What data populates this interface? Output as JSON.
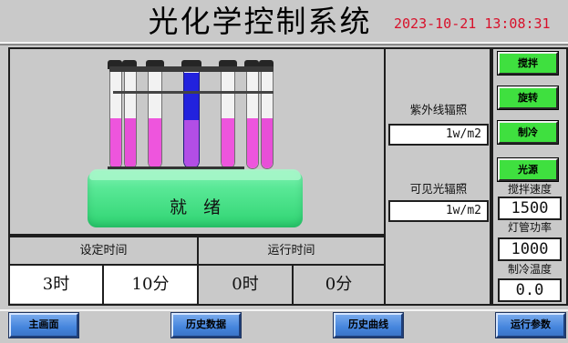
{
  "header": {
    "title": "光化学控制系统",
    "datetime": "2023-10-21  13:08:31"
  },
  "reactor": {
    "status": "就绪"
  },
  "time": {
    "set_label": "设定时间",
    "run_label": "运行时间",
    "set_hours": "3时",
    "set_minutes": "10分",
    "run_hours": "0时",
    "run_minutes": "0分"
  },
  "radiation": {
    "uv_label": "紫外线辐照",
    "uv_value": "1w/m2",
    "visible_label": "可见光辐照",
    "visible_value": "1w/m2"
  },
  "controls": {
    "stir_label": "搅拌",
    "rotate_label": "旋转",
    "cool_label": "制冷",
    "light_label": "光源"
  },
  "params": {
    "stir_speed_label": "搅拌速度",
    "stir_speed_value": "1500",
    "lamp_power_label": "灯管功率",
    "lamp_power_value": "1000",
    "cooling_temp_label": "制冷温度",
    "cooling_temp_value": "0.0"
  },
  "nav": {
    "home": "主画面",
    "history_data": "历史数据",
    "history_curve": "历史曲线",
    "run_params": "运行参数"
  },
  "colors": {
    "status_green": "#3fe03f",
    "nav_blue": "#4585dd",
    "datetime_red": "#d8102a",
    "liquid_magenta": "#ee55dd",
    "liquid_blue": "#2222dd"
  }
}
